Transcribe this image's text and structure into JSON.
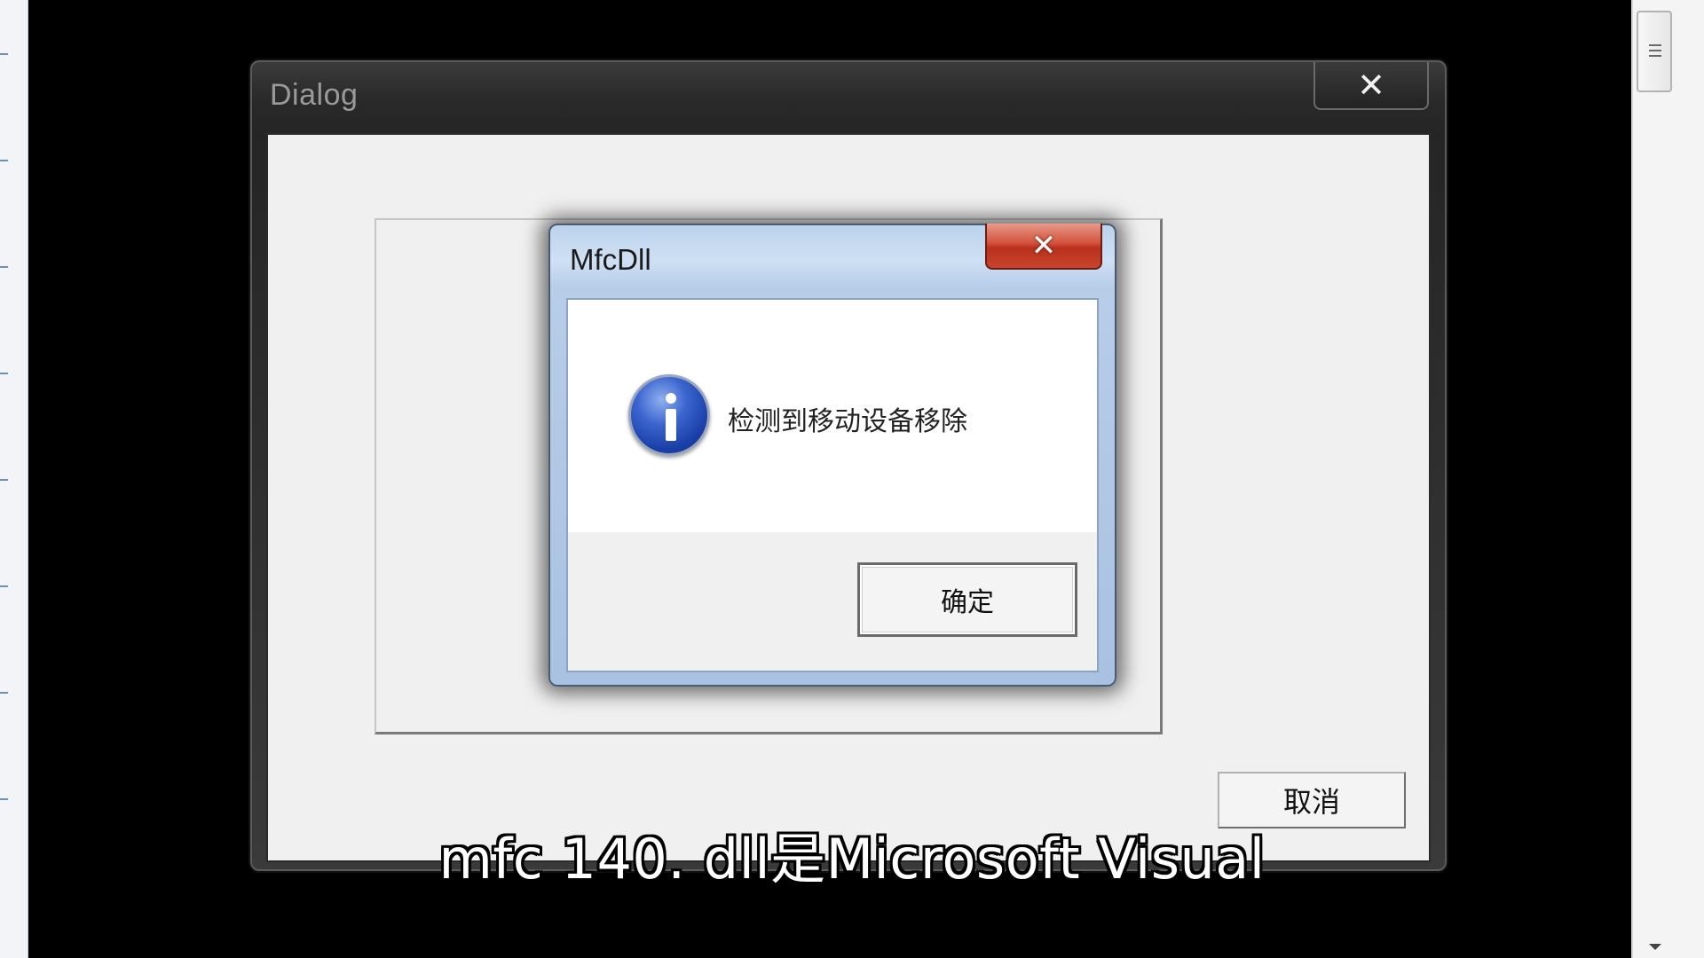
{
  "dialog": {
    "title": "Dialog",
    "close_glyph": "✕",
    "cancel_label": "取消"
  },
  "message_box": {
    "title": "MfcDll",
    "close_glyph": "✕",
    "icon": "info-icon",
    "message": "检测到移动设备移除",
    "ok_label": "确定"
  },
  "subtitle": {
    "text": "mfc 140. dll是Microsoft Visual"
  },
  "colors": {
    "message_box_frame": "#b7cde8",
    "close_button_red": "#c8442c",
    "info_icon_blue": "#2a4fc0"
  }
}
